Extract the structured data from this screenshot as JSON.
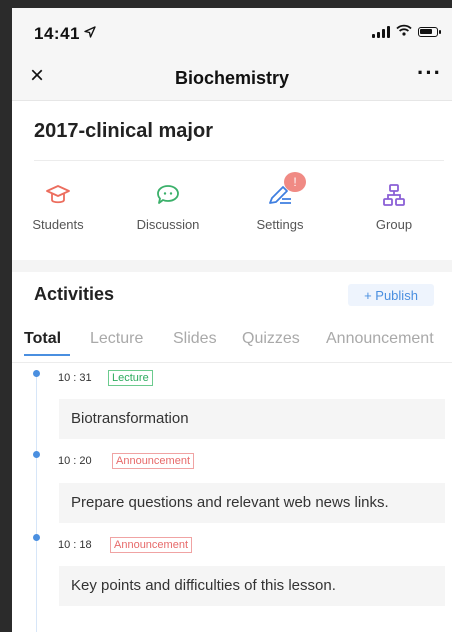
{
  "status_bar": {
    "time": "14:41"
  },
  "navbar": {
    "title": "Biochemistry",
    "close_icon": "×",
    "more_icon": "···"
  },
  "class_info": {
    "name": "2017-clinical major"
  },
  "quick_actions": [
    {
      "label": "Students",
      "icon": "graduation-cap-icon",
      "color": "#ec6d5e"
    },
    {
      "label": "Discussion",
      "icon": "chat-bubble-icon",
      "color": "#3bb06a"
    },
    {
      "label": "Settings",
      "icon": "edit-pen-icon",
      "color": "#3f7fe0",
      "badge": "!"
    },
    {
      "label": "Group",
      "icon": "group-tree-icon",
      "color": "#8a5fd6"
    }
  ],
  "activities": {
    "title": "Activities",
    "publish_label": "+ Publish",
    "tabs": [
      "Total",
      "Lecture",
      "Slides",
      "Quizzes",
      "Announcement"
    ],
    "active_tab": "Total",
    "items": [
      {
        "time": "10 : 31",
        "tag": "Lecture",
        "text": "Biotransformation"
      },
      {
        "time": "10 : 20",
        "tag": "Announcement",
        "text": "Prepare questions and relevant web news links."
      },
      {
        "time": "10 : 18",
        "tag": "Announcement",
        "text": "Key points and difficulties of this lesson."
      }
    ]
  },
  "colors": {
    "accent": "#4a8fe0",
    "lecture_tag": "#2dab5e",
    "announcement_tag": "#e76a6a",
    "badge": "#f08a84"
  }
}
